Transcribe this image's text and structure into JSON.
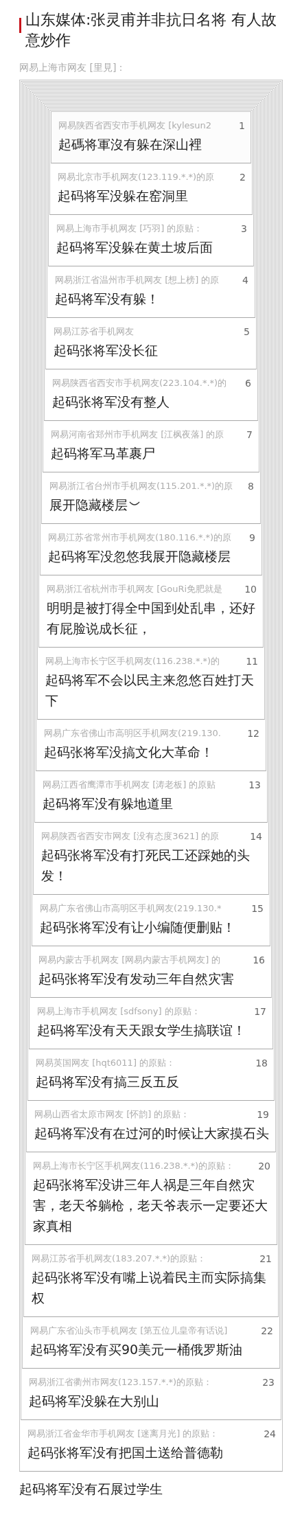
{
  "article": {
    "title": "山东媒体:张灵甫并非抗日名将 有人故意炒作"
  },
  "comment": {
    "author": "网易上海市网友 [里見]：",
    "quoted_posts": [
      {
        "kind": "comment",
        "author": "网易陕西省西安市手机网友 [kylesun2",
        "floor": "1",
        "text": "起碼将軍沒有躲在深山裡"
      },
      {
        "kind": "comment",
        "author": "网易北京市手机网友(123.119.*.*)的原",
        "floor": "2",
        "text": "起码将军没躲在窑洞里"
      },
      {
        "kind": "comment",
        "author": "网易上海市手机网友 [巧羽] 的原贴：",
        "floor": "3",
        "text": "起码将军没躲在黄土坡后面"
      },
      {
        "kind": "comment",
        "author": "网易浙江省温州市手机网友 [想上榜] 的原",
        "floor": "4",
        "text": "起码将军没有躲！"
      },
      {
        "kind": "comment",
        "author": "网易江苏省手机网友",
        "floor": "5",
        "text": "起码张将军没长征"
      },
      {
        "kind": "comment",
        "author": "网易陕西省西安市手机网友(223.104.*.*)的",
        "floor": "6",
        "text": "起码张将军没有整人"
      },
      {
        "kind": "comment",
        "author": "网易河南省郑州市手机网友 [江枫夜落] 的原",
        "floor": "7",
        "text": "起码将军马革裹尸"
      },
      {
        "kind": "expand",
        "author": "网易浙江省台州市手机网友(115.201.*.*)的原",
        "floor": "8",
        "text": "展开隐藏楼层"
      },
      {
        "kind": "comment",
        "author": "网易江苏省常州市手机网友(180.116.*.*)的原",
        "floor": "9",
        "text": "起码将军没忽悠我展开隐藏楼层"
      },
      {
        "kind": "comment",
        "author": "网易浙江省杭州市手机网友 [GouRi免肥就是",
        "floor": "10",
        "text": "明明是被打得全中国到处乱串，还好有屁脸说成长征，"
      },
      {
        "kind": "comment",
        "author": "网易上海市长宁区手机网友(116.238.*.*)的",
        "floor": "11",
        "text": "起码将军不会以民主来忽悠百姓打天下"
      },
      {
        "kind": "comment",
        "author": "网易广东省佛山市高明区手机网友(219.130.",
        "floor": "12",
        "text": "起码张将军没搞文化大革命！"
      },
      {
        "kind": "comment",
        "author": "网易江西省鹰潭市手机网友 [涛老板] 的原贴",
        "floor": "13",
        "text": "起码将军没有躲地道里"
      },
      {
        "kind": "comment",
        "author": "网易陕西省西安市网友 [没有态度3621] 的原",
        "floor": "14",
        "text": "起码张将军没有打死民工还踩她的头发！"
      },
      {
        "kind": "comment",
        "author": "网易广东省佛山市高明区手机网友(219.130.*",
        "floor": "15",
        "text": "起码张将军没有让小编随便删贴！"
      },
      {
        "kind": "comment",
        "author": "网易内蒙古手机网友 [网易内蒙古手机网友] 的",
        "floor": "16",
        "text": "起码张将军没有发动三年自然灾害"
      },
      {
        "kind": "comment",
        "author": "网易上海市手机网友 [sdfsony] 的原贴：",
        "floor": "17",
        "text": "起码将军没有天天跟女学生搞联谊！"
      },
      {
        "kind": "comment",
        "author": "网易英国网友 [hqt6011] 的原贴：",
        "floor": "18",
        "text": "起码将军没有搞三反五反"
      },
      {
        "kind": "comment",
        "author": "网易山西省太原市网友 [怀韵] 的原贴：",
        "floor": "19",
        "text": "起码将军没有在过河的时候让大家摸石头"
      },
      {
        "kind": "comment",
        "author": "网易上海市长宁区手机网友(116.238.*.*)的原贴：",
        "floor": "20",
        "text": "起码张将军没讲三年人祸是三年自然灾害，老天爷躺枪，老天爷表示一定要还大家真相"
      },
      {
        "kind": "comment",
        "author": "网易江苏省手机网友(183.207.*.*)的原贴：",
        "floor": "21",
        "text": "起码张将军没有嘴上说着民主而实际搞集权"
      },
      {
        "kind": "comment",
        "author": "网易广东省汕头市手机网友 [第五位儿皇帝有话说]",
        "floor": "22",
        "text": "起码将军没有买90美元一桶俄罗斯油"
      },
      {
        "kind": "comment",
        "author": "网易浙江省衢州市网友(123.157.*.*)的原贴：",
        "floor": "23",
        "text": "起码将军没躲在大别山"
      },
      {
        "kind": "comment",
        "author": "网易浙江省金华市手机网友 [迷离月光] 的原贴：",
        "floor": "24",
        "text": "起码张将军没有把国土送给普德勒"
      }
    ],
    "text": "起码将军没有石展过学生"
  }
}
